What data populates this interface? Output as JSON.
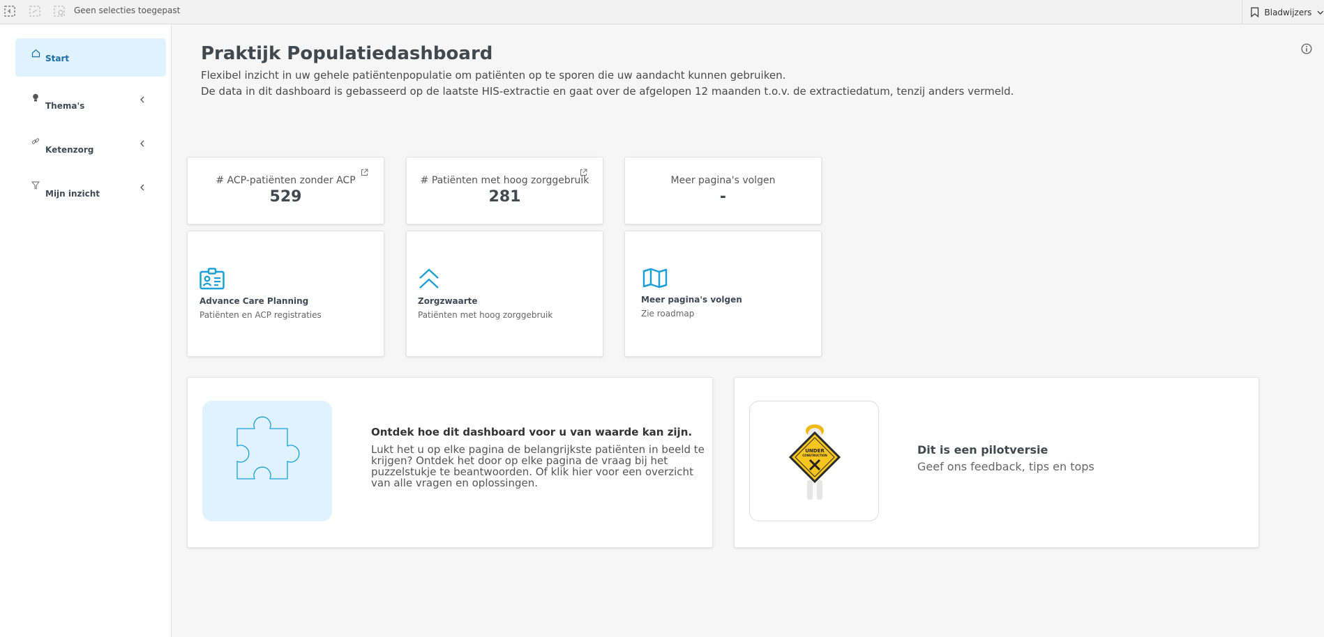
{
  "topbar": {
    "selection_text": "Geen selecties toegepast",
    "bookmarks_label": "Bladwijzers"
  },
  "sidebar": {
    "items": [
      {
        "label": "Start",
        "icon": "home-icon",
        "active": true
      },
      {
        "label": "Thema's",
        "icon": "lightbulb-icon",
        "active": false
      },
      {
        "label": "Ketenzorg",
        "icon": "link-icon",
        "active": false
      },
      {
        "label": "Mijn inzicht",
        "icon": "filter-icon",
        "active": false
      }
    ]
  },
  "main": {
    "title": "Praktijk Populatiedashboard",
    "subtitle_line1": "Flexibel inzicht in uw gehele patiëntenpopulatie om patiënten op te sporen die uw aandacht kunnen gebruiken.",
    "subtitle_line2": "De data in dit dashboard is gebasseerd op de laatste HIS-extractie en gaat over de afgelopen 12 maanden t.o.v. de extractiedatum, tenzij anders vermeld.",
    "kpis": [
      {
        "label": "# ACP-patiënten zonder ACP",
        "value": "529"
      },
      {
        "label": "# Patiënten met hoog zorggebruik",
        "value": "281"
      },
      {
        "label": "Meer pagina's volgen",
        "value": "-"
      }
    ],
    "nav_cards": [
      {
        "title": "Advance Care Planning",
        "subtitle": "Patiënten en ACP registraties",
        "icon": "id-card-icon"
      },
      {
        "title": "Zorgzwaarte",
        "subtitle": "Patiënten met hoog zorggebruik",
        "icon": "double-chevron-up-icon"
      },
      {
        "title": "Meer pagina's volgen",
        "subtitle": "Zie roadmap",
        "icon": "map-icon"
      }
    ],
    "promo": {
      "title": "Ontdek hoe dit dashboard voor u van waarde kan zijn.",
      "text": "Lukt het u op elke pagina de belangrijkste patiënten in beeld te krijgen? Ontdek het door op elke pagina de vraag bij het puzzelstukje te beantwoorden. Of klik hier voor een overzicht van alle vragen en oplossingen."
    },
    "pilot": {
      "title": "Dit is een pilotversie",
      "subtitle": "Geef ons feedback, tips en tops",
      "sign_text": "UNDER CONSTRUCTION"
    }
  },
  "colors": {
    "accent": "#1a9fd6",
    "active_nav_bg": "#dff2fd",
    "sign_yellow": "#f7c51e"
  }
}
